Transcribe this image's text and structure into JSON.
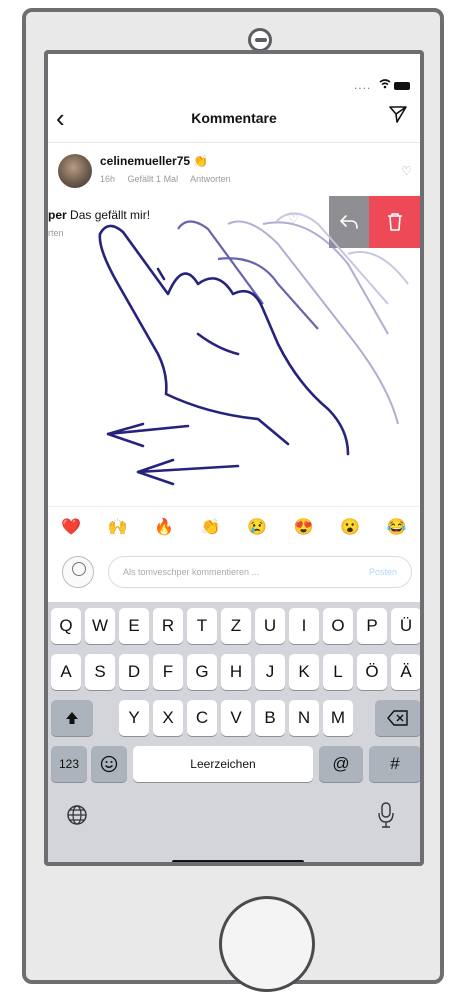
{
  "nav": {
    "back_icon": "chevron-left-icon",
    "title": "Kommentare",
    "send_icon": "paper-plane-icon"
  },
  "comment1": {
    "username": "celinemueller75",
    "emoji": "👏",
    "time": "16h",
    "likes": "Gefällt 1 Mal",
    "reply": "Antworten"
  },
  "comment2": {
    "user_fragment": "per",
    "text": "Das gefällt mir!",
    "reply_fragment": "rten"
  },
  "swipe_actions": {
    "reply_icon": "reply-arrow-icon",
    "delete_icon": "trash-icon",
    "reply_color": "#8e8e93",
    "delete_color": "#ed4956"
  },
  "emoji_bar": [
    "❤️",
    "🙌",
    "🔥",
    "👏",
    "😢",
    "😍",
    "😮",
    "😂"
  ],
  "comment_input": {
    "placeholder": "Als tomveschper kommentieren ...",
    "post_label": "Posten"
  },
  "keyboard": {
    "row1": [
      "Q",
      "W",
      "E",
      "R",
      "T",
      "Z",
      "U",
      "I",
      "O",
      "P",
      "Ü"
    ],
    "row2": [
      "A",
      "S",
      "D",
      "F",
      "G",
      "H",
      "J",
      "K",
      "L",
      "Ö",
      "Ä"
    ],
    "row3": [
      "Y",
      "X",
      "C",
      "V",
      "B",
      "N",
      "M"
    ],
    "numbers_key": "123",
    "space_key": "Leerzeichen",
    "at_key": "@",
    "hash_key": "#"
  }
}
